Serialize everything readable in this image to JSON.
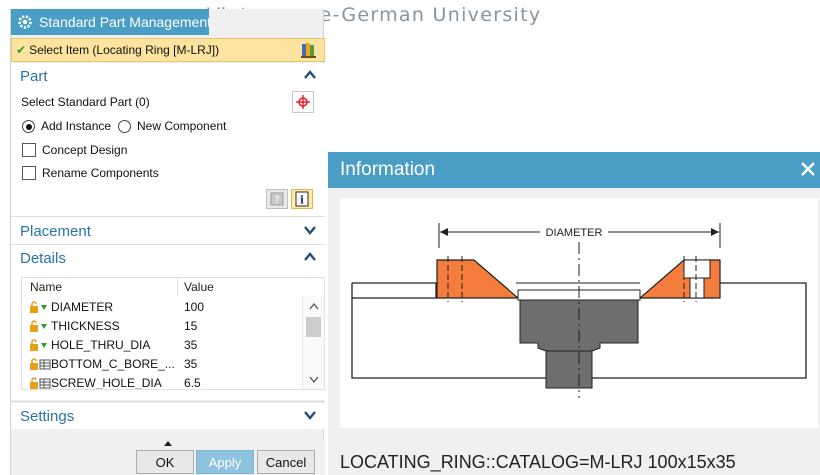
{
  "watermark": "Vietnamese-German University",
  "dialog": {
    "title": "Standard Part Management",
    "select_item": "Select Item (Locating Ring [M-LRJ])",
    "part_section": {
      "title": "Part",
      "select_standard_part": "Select Standard Part (0)",
      "add_instance": "Add Instance",
      "new_component": "New Component",
      "concept_design": "Concept Design",
      "rename_components": "Rename Components"
    },
    "placement_title": "Placement",
    "details": {
      "title": "Details",
      "col_name": "Name",
      "col_value": "Value",
      "rows": [
        {
          "name": "DIAMETER",
          "value": "100"
        },
        {
          "name": "THICKNESS",
          "value": "15"
        },
        {
          "name": "HOLE_THRU_DIA",
          "value": "35"
        },
        {
          "name": "BOTTOM_C_BORE_...",
          "value": "35"
        },
        {
          "name": "SCREW_HOLE_DIA",
          "value": "6.5"
        }
      ]
    },
    "settings_title": "Settings",
    "buttons": {
      "ok": "OK",
      "apply": "Apply",
      "cancel": "Cancel"
    }
  },
  "info_window": {
    "title": "Information",
    "dimension_label": "DIAMETER",
    "catalog_text": "LOCATING_RING::CATALOG=M-LRJ  100x15x35"
  },
  "colors": {
    "titlebar": "#4a9ec6",
    "select_highlight": "#fce3a0",
    "section_heading": "#2a73a8",
    "ring_orange": "#f47c3c",
    "part_gray": "#6e6e6e"
  }
}
